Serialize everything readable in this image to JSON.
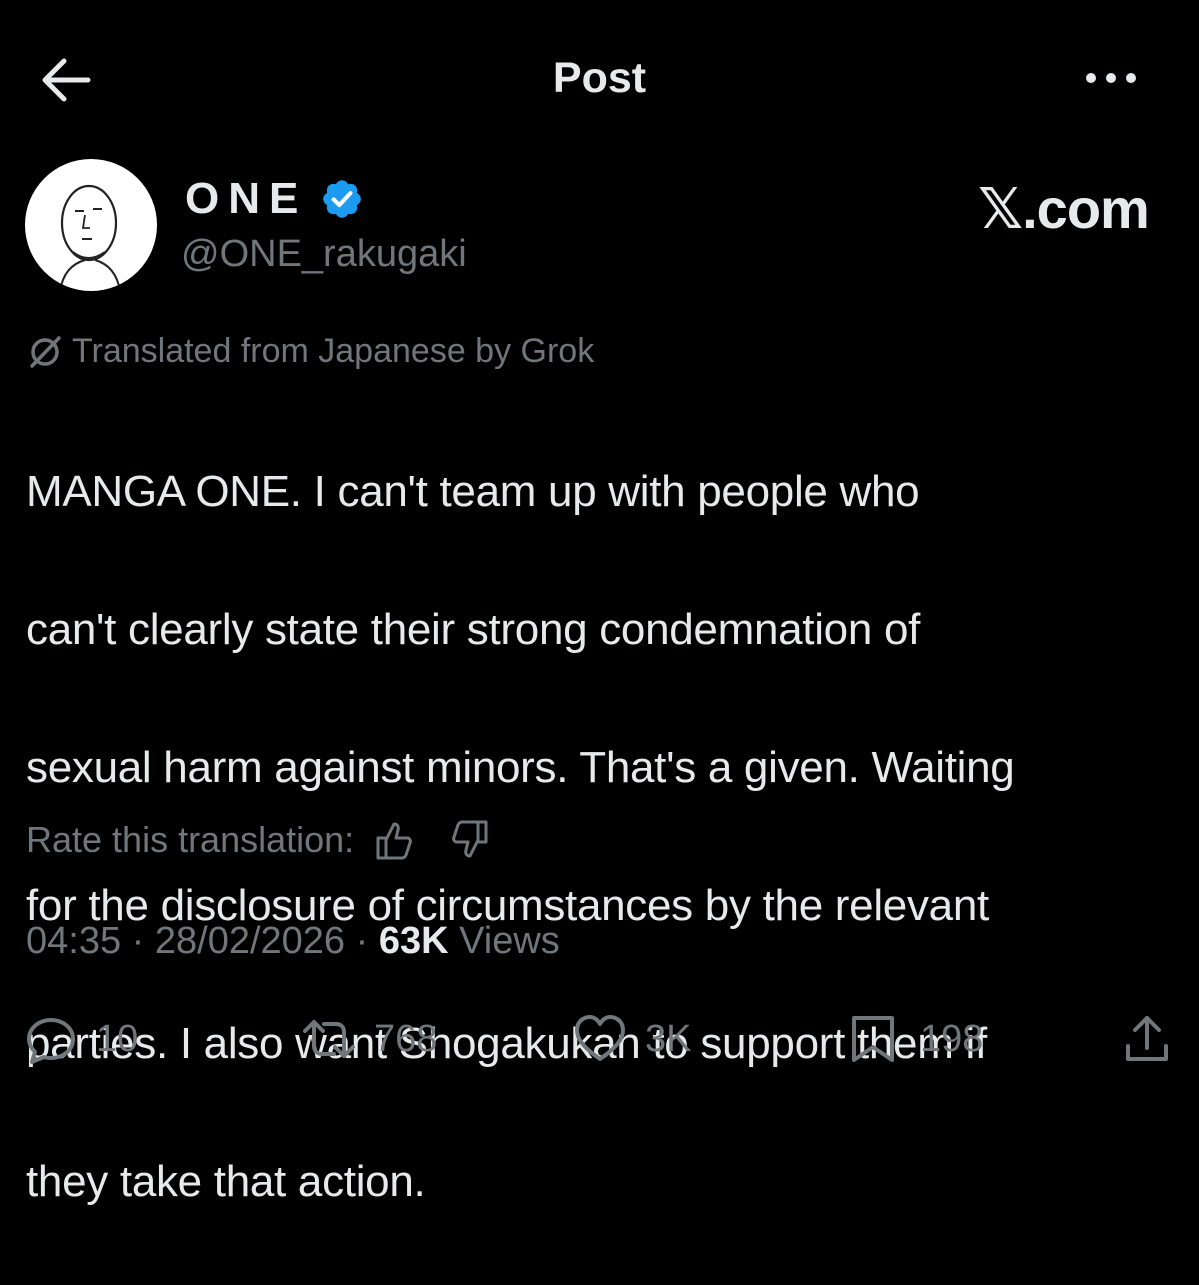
{
  "header": {
    "title": "Post",
    "back_icon": "arrow-left-icon",
    "more_icon": "more-icon"
  },
  "author": {
    "display_name": "ONE",
    "handle": "@ONE_rakugaki",
    "verified_color": "#1d9bf0",
    "avatar_icon": "avatar-sketch"
  },
  "brand": {
    "label": "𝕏.com"
  },
  "translation": {
    "label": "Translated from Japanese by Grok"
  },
  "post": {
    "lines": [
      "MANGA ONE. I can't team up with people who",
      "can't clearly state their strong condemnation of",
      "sexual harm against minors. That's a given. Waiting",
      "for the disclosure of circumstances by the relevant",
      "parties. I also want Shogakukan to support them if",
      "they take that action."
    ]
  },
  "rating": {
    "label": "Rate this translation:"
  },
  "meta": {
    "time": "04:35",
    "date": "28/02/2026",
    "views_count": "63K",
    "views_label": "Views",
    "separator": "·"
  },
  "actions": {
    "replies": "10",
    "reposts": "768",
    "likes": "3K",
    "bookmarks": "198"
  },
  "colors": {
    "background": "#000000",
    "text": "#e7e9ea",
    "muted": "#71767b",
    "accent": "#1d9bf0"
  }
}
